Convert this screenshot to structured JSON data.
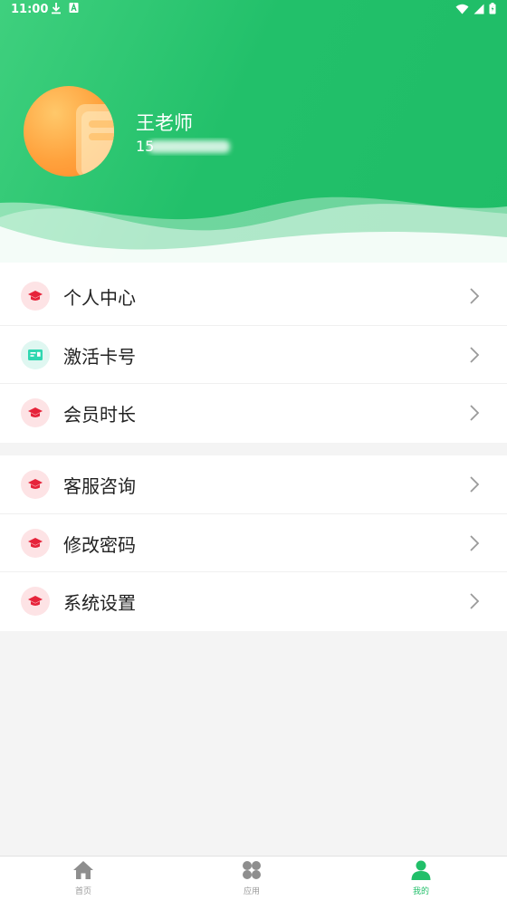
{
  "status_bar": {
    "time": "11:00",
    "left_icons": [
      "download-icon",
      "notification-a-icon"
    ],
    "right_icons": [
      "wifi-icon",
      "signal-icon",
      "battery-icon"
    ]
  },
  "profile": {
    "name": "王老师",
    "phone_visible": "15"
  },
  "menu_group_1": [
    {
      "label": "个人中心",
      "icon": "graduation-cap-icon"
    },
    {
      "label": "激活卡号",
      "icon": "id-card-icon"
    },
    {
      "label": "会员时长",
      "icon": "graduation-cap-icon"
    }
  ],
  "menu_group_2": [
    {
      "label": "客服咨询",
      "icon": "graduation-cap-icon"
    },
    {
      "label": "修改密码",
      "icon": "graduation-cap-icon"
    },
    {
      "label": "系统设置",
      "icon": "graduation-cap-icon"
    }
  ],
  "bottom_nav": [
    {
      "label": "首页",
      "icon": "home-icon"
    },
    {
      "label": "应用",
      "icon": "apps-icon"
    },
    {
      "label": "我的",
      "icon": "user-icon",
      "active": true
    }
  ],
  "colors": {
    "brand_green": "#21bf69",
    "icon_red": "#e6233a",
    "icon_teal": "#2fd7b0",
    "icon_bg_pink": "#fde3e5"
  }
}
